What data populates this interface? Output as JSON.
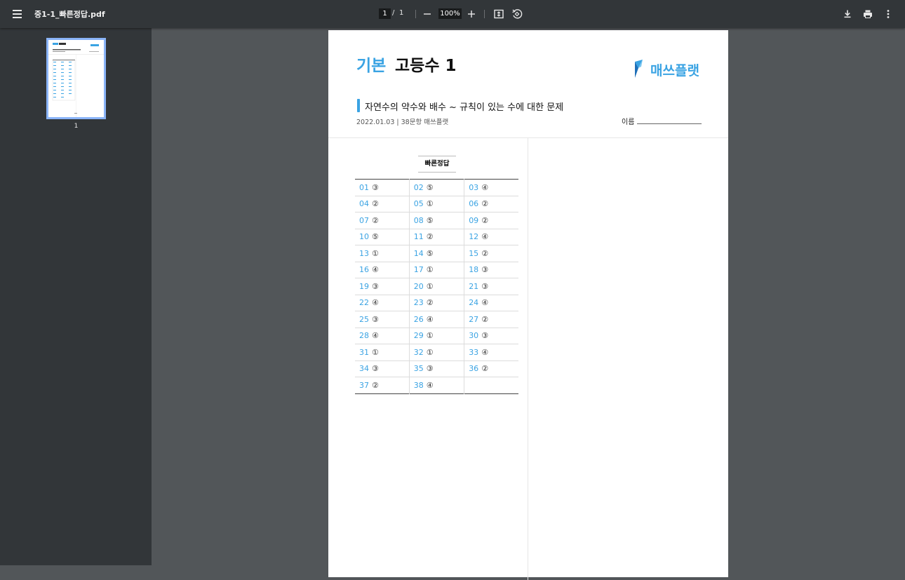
{
  "toolbar": {
    "filename": "중1-1_빠른정답.pdf",
    "page_current": "1",
    "page_separator": "/",
    "page_total": "1",
    "zoom_minus": "−",
    "zoom_value": "100%",
    "zoom_plus": "+"
  },
  "sidebar": {
    "thumb_label": "1"
  },
  "document": {
    "title_prefix": "기본",
    "title_main": "고등수 1",
    "logo_text": "매쓰플랫",
    "subtitle": "자연수의 약수와 배수 ~ 규칙이 있는 수에 대한 문제",
    "meta": "2022.01.03 | 38문항 매쓰플랫",
    "name_label": "이름",
    "answers_title": "빠른정답",
    "answers": [
      [
        {
          "n": "01",
          "a": "③"
        },
        {
          "n": "02",
          "a": "⑤"
        },
        {
          "n": "03",
          "a": "④"
        }
      ],
      [
        {
          "n": "04",
          "a": "②"
        },
        {
          "n": "05",
          "a": "①"
        },
        {
          "n": "06",
          "a": "②"
        }
      ],
      [
        {
          "n": "07",
          "a": "②"
        },
        {
          "n": "08",
          "a": "⑤"
        },
        {
          "n": "09",
          "a": "②"
        }
      ],
      [
        {
          "n": "10",
          "a": "⑤"
        },
        {
          "n": "11",
          "a": "②"
        },
        {
          "n": "12",
          "a": "④"
        }
      ],
      [
        {
          "n": "13",
          "a": "①"
        },
        {
          "n": "14",
          "a": "⑤"
        },
        {
          "n": "15",
          "a": "②"
        }
      ],
      [
        {
          "n": "16",
          "a": "④"
        },
        {
          "n": "17",
          "a": "①"
        },
        {
          "n": "18",
          "a": "③"
        }
      ],
      [
        {
          "n": "19",
          "a": "③"
        },
        {
          "n": "20",
          "a": "①"
        },
        {
          "n": "21",
          "a": "③"
        }
      ],
      [
        {
          "n": "22",
          "a": "④"
        },
        {
          "n": "23",
          "a": "②"
        },
        {
          "n": "24",
          "a": "④"
        }
      ],
      [
        {
          "n": "25",
          "a": "③"
        },
        {
          "n": "26",
          "a": "④"
        },
        {
          "n": "27",
          "a": "②"
        }
      ],
      [
        {
          "n": "28",
          "a": "④"
        },
        {
          "n": "29",
          "a": "①"
        },
        {
          "n": "30",
          "a": "③"
        }
      ],
      [
        {
          "n": "31",
          "a": "①"
        },
        {
          "n": "32",
          "a": "①"
        },
        {
          "n": "33",
          "a": "④"
        }
      ],
      [
        {
          "n": "34",
          "a": "③"
        },
        {
          "n": "35",
          "a": "③"
        },
        {
          "n": "36",
          "a": "②"
        }
      ],
      [
        {
          "n": "37",
          "a": "②"
        },
        {
          "n": "38",
          "a": "④"
        },
        {
          "n": "",
          "a": ""
        }
      ]
    ]
  },
  "colors": {
    "accent": "#3aa3e3",
    "toolbar_bg": "#323639",
    "viewer_bg": "#525659",
    "thumb_border": "#8ab4f8"
  },
  "icons": [
    "menu-icon",
    "zoom-out-icon",
    "zoom-in-icon",
    "fit-page-icon",
    "rotate-icon",
    "download-icon",
    "print-icon",
    "more-vert-icon"
  ]
}
